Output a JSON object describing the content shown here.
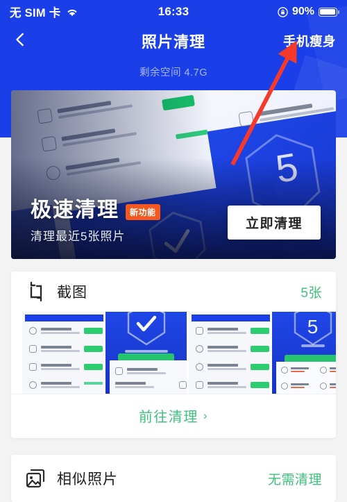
{
  "statusbar": {
    "carrier": "无 SIM 卡",
    "wifi_icon": "wifi-icon",
    "time": "16:33",
    "orientation_lock_icon": "rotation-lock-icon",
    "battery_percent": "90%",
    "battery_icon": "battery-icon"
  },
  "navbar": {
    "back_icon": "chevron-left-icon",
    "title": "照片清理",
    "right_action": "手机瘦身"
  },
  "header": {
    "storage_label": "剩余空间 4.7G"
  },
  "banner": {
    "title": "极速清理",
    "badge": "新功能",
    "subtitle": "清理最近5张照片",
    "cta": "立即清理"
  },
  "cards": [
    {
      "id": "screenshots",
      "icon": "screenshot-crop-icon",
      "title": "截图",
      "meta": "5张",
      "meta_color": "#3fc07c",
      "action": "前往清理",
      "action_chevron": "chevron-right-icon",
      "thumbnail_count": 4
    },
    {
      "id": "similar",
      "icon": "similar-photos-icon",
      "title": "相似照片",
      "meta": "无需清理",
      "meta_color": "#3fc07c"
    }
  ],
  "annotation": {
    "type": "arrow",
    "color": "#f5392b",
    "points_to": "手机瘦身"
  },
  "colors": {
    "header_blue": "#1a3fe8",
    "accent_green": "#3fc07c",
    "badge_orange": "#f4581f",
    "page_bg": "#f3f3f3"
  }
}
